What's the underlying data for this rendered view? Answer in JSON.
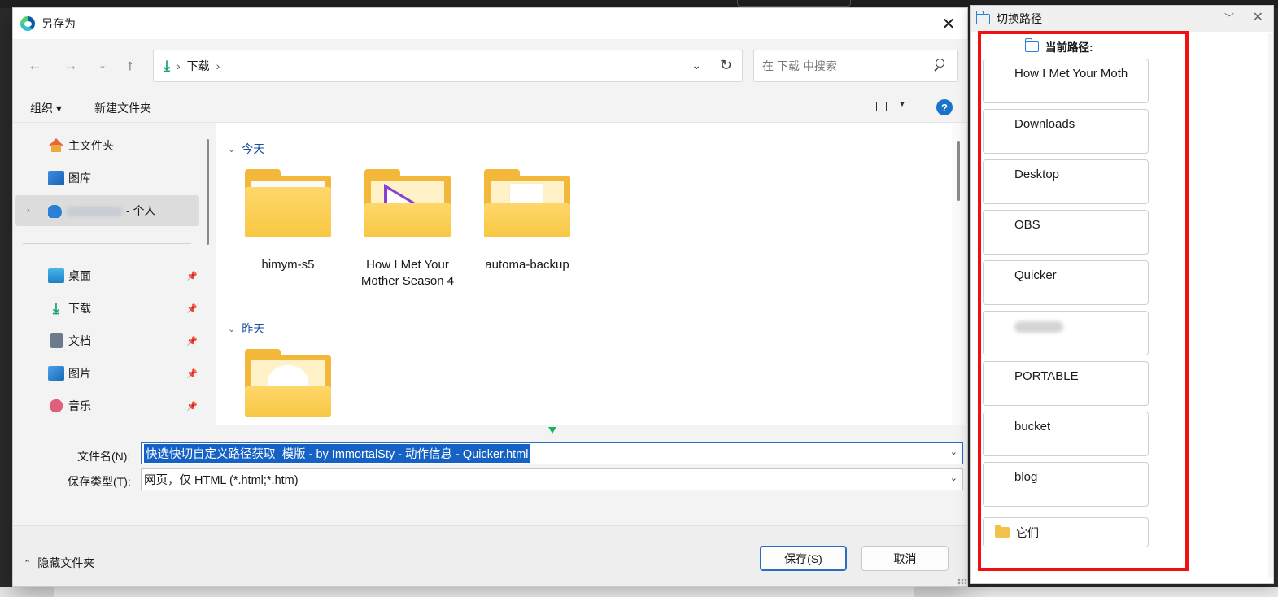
{
  "dialog": {
    "title": "另存为",
    "address": {
      "location": "下载"
    },
    "search": {
      "placeholder": "在 下载 中搜索"
    },
    "commands": {
      "organize": "组织 ▾",
      "new_folder": "新建文件夹",
      "help": "?"
    },
    "nav": {
      "items": [
        {
          "label": "主文件夹",
          "icon": "home-icon"
        },
        {
          "label": "图库",
          "icon": "gallery-icon"
        },
        {
          "label": "- 个人",
          "icon": "onedrive-cloud-icon"
        },
        {
          "label": "桌面",
          "icon": "desktop-icon"
        },
        {
          "label": "下载",
          "icon": "download-icon"
        },
        {
          "label": "文档",
          "icon": "document-icon"
        },
        {
          "label": "图片",
          "icon": "pictures-icon"
        },
        {
          "label": "音乐",
          "icon": "music-icon"
        }
      ]
    },
    "groups": [
      {
        "label": "今天",
        "items": [
          "himym-s5",
          "How I Met Your Mother Season 4",
          "automa-backup"
        ]
      },
      {
        "label": "昨天",
        "items": [
          ""
        ]
      }
    ],
    "form": {
      "filename_label": "文件名(N):",
      "filename_value": "快选快切自定义路径获取_模版 - by ImmortalSty - 动作信息 - Quicker.html",
      "filetype_label": "保存类型(T):",
      "filetype_value": "网页，仅 HTML (*.html;*.htm)"
    },
    "footer": {
      "hide_folders": "隐藏文件夹",
      "save": "保存(S)",
      "cancel": "取消"
    }
  },
  "panel": {
    "title": "切换路径",
    "current_path_label": "当前路径:",
    "paths": [
      "How I Met Your Moth",
      "Downloads",
      "Desktop",
      "OBS",
      "Quicker",
      "",
      "PORTABLE",
      "bucket",
      "blog"
    ],
    "others_label": "它们"
  },
  "colors": {
    "accent": "#1662c4",
    "highlight_frame": "#f01010",
    "folder": "#f7c843"
  }
}
